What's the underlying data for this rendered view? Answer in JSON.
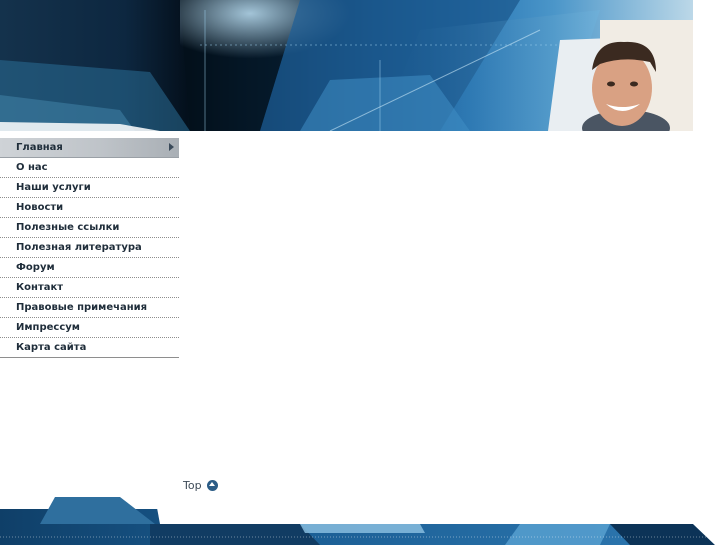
{
  "nav": {
    "items": [
      {
        "label": "Главная",
        "active": true
      },
      {
        "label": "О нас"
      },
      {
        "label": "Наши услуги"
      },
      {
        "label": "Новости"
      },
      {
        "label": "Полезные ссылки"
      },
      {
        "label": "Полезная литература"
      },
      {
        "label": "Форум"
      },
      {
        "label": "Контакт"
      },
      {
        "label": "Правовые примечания"
      },
      {
        "label": "Импрессум"
      },
      {
        "label": "Карта сайта"
      }
    ]
  },
  "footer": {
    "top_label": "Top"
  },
  "colors": {
    "header_dark": "#04101c",
    "header_blue": "#2a78b5",
    "nav_text": "#1f2d3a",
    "active_bg": "#c4c9ce",
    "footer_blue": "#1b5e94"
  },
  "icons": {
    "top": "arrow-up-circle-icon",
    "active_marker": "triangle-right-icon"
  }
}
